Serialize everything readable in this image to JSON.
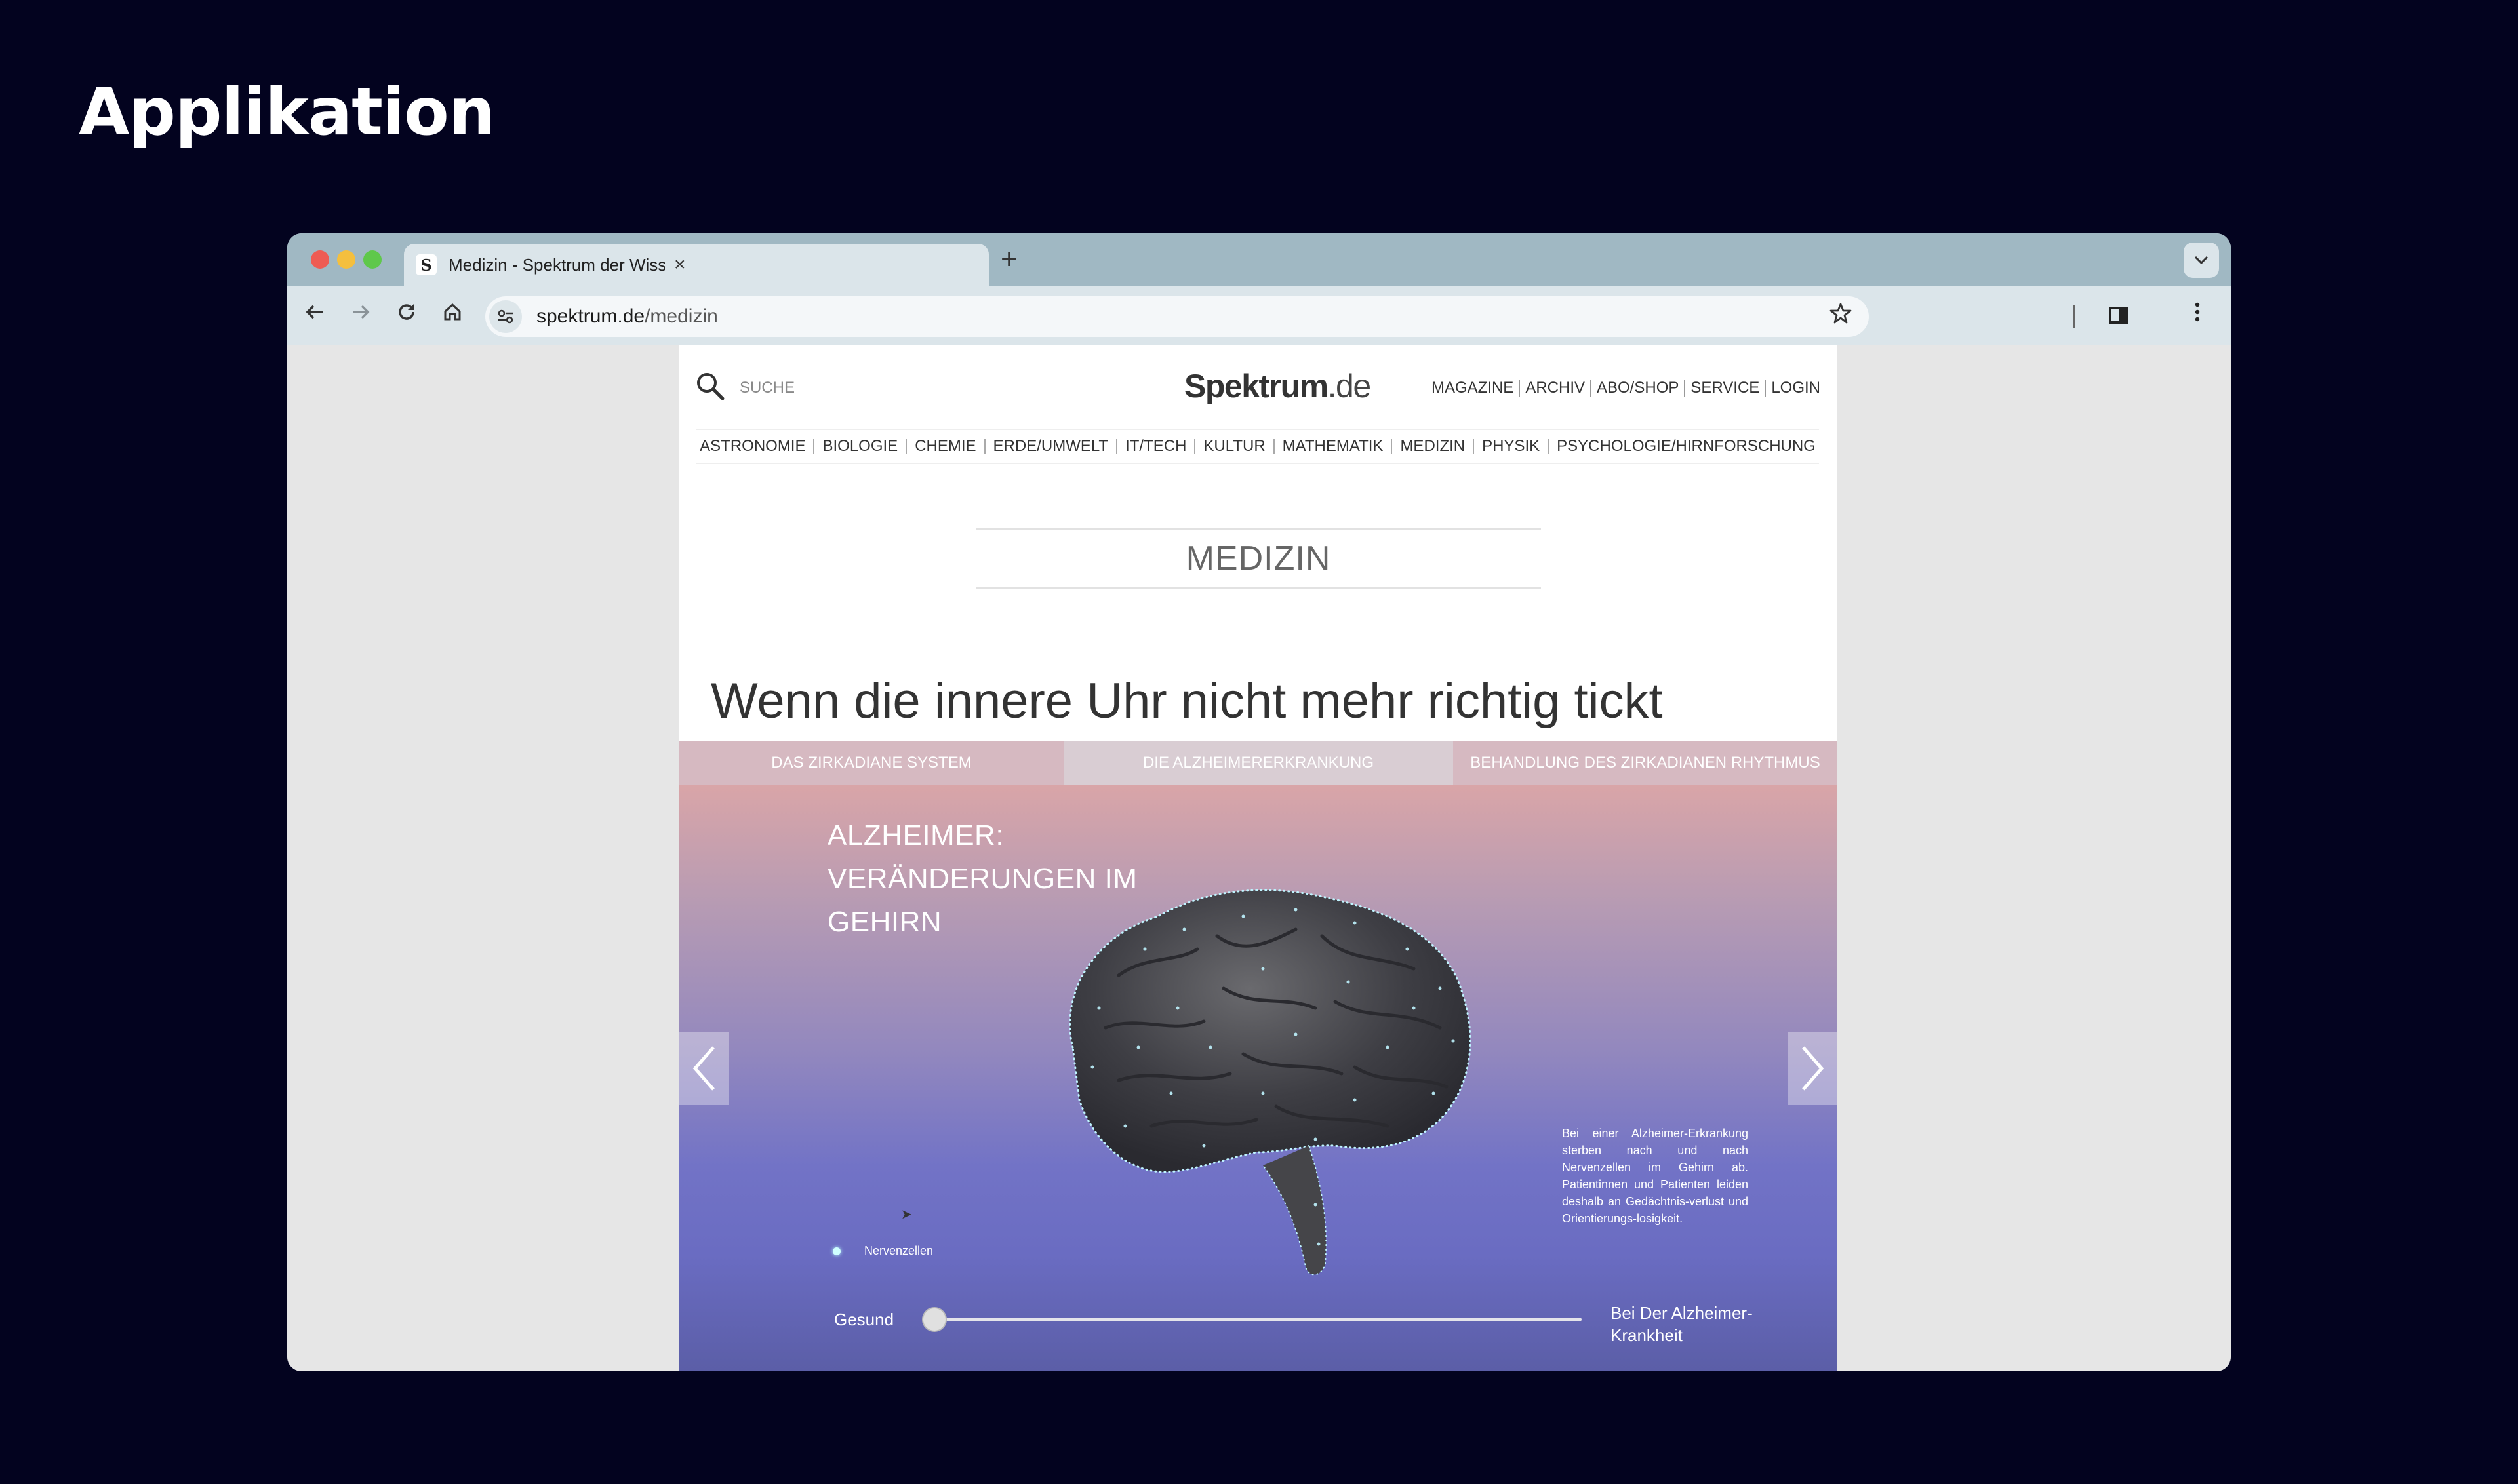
{
  "slide": {
    "title": "Applikation"
  },
  "browser": {
    "tab_favicon": "S",
    "tab_title": "Medizin - Spektrum der Wiss",
    "tab_close": "×",
    "new_tab": "+",
    "url_host": "spektrum.de",
    "url_path": "/medizin"
  },
  "site": {
    "search_label": "SUCHE",
    "logo_main": "Spektrum",
    "logo_suffix": ".de",
    "top_nav": [
      "MAGAZINE",
      "ARCHIV",
      "ABO/SHOP",
      "SERVICE",
      "LOGIN"
    ],
    "categories": [
      "ASTRONOMIE",
      "BIOLOGIE",
      "CHEMIE",
      "ERDE/UMWELT",
      "IT/TECH",
      "KULTUR",
      "MATHEMATIK",
      "MEDIZIN",
      "PHYSIK",
      "PSYCHOLOGIE/HIRNFORSCHUNG"
    ],
    "section": "MEDIZIN",
    "headline": "Wenn die innere Uhr nicht mehr richtig tickt"
  },
  "story": {
    "tabs": [
      "DAS ZIRKADIANE SYSTEM",
      "DIE ALZHEIMERERKRANKUNG",
      "BEHANDLUNG DES ZIRKADIANEN RHYTHMUS"
    ],
    "active_tab": 1,
    "viz_title": "ALZHEIMER: VERÄNDERUNGEN IM GEHIRN",
    "description": "Bei einer Alzheimer-Erkrankung sterben nach und nach Nervenzellen im Gehirn ab. Patientinnen und Patienten leiden deshalb an Gedächtnis-verlust und Orientierungs-losigkeit.",
    "legend_label": "Nervenzellen",
    "slider_left": "Gesund",
    "slider_right": "Bei Der Alzheimer-Krankheit",
    "slider_value": 0
  },
  "colors": {
    "background": "#03031f",
    "browser_frame": "#a0b8c3",
    "neuron_dots": "#bff4ff"
  },
  "icons": [
    "search-icon",
    "back-arrow-icon",
    "forward-arrow-icon",
    "reload-icon",
    "home-icon",
    "site-info-icon",
    "bookmark-star-icon",
    "side-panel-icon",
    "kebab-menu-icon",
    "chevron-left-icon",
    "chevron-right-icon"
  ]
}
